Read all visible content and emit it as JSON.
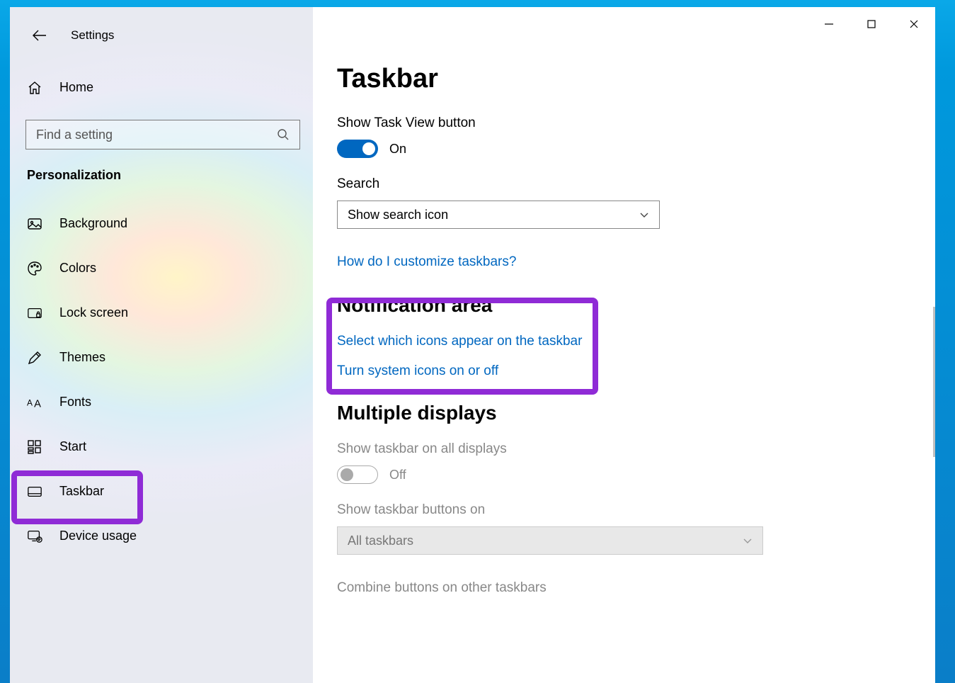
{
  "app_title": "Settings",
  "sidebar": {
    "home": "Home",
    "search_placeholder": "Find a setting",
    "category": "Personalization",
    "items": [
      {
        "label": "Background"
      },
      {
        "label": "Colors"
      },
      {
        "label": "Lock screen"
      },
      {
        "label": "Themes"
      },
      {
        "label": "Fonts"
      },
      {
        "label": "Start"
      },
      {
        "label": "Taskbar"
      },
      {
        "label": "Device usage"
      }
    ]
  },
  "main": {
    "title": "Taskbar",
    "taskview_label": "Show Task View button",
    "taskview_state": "On",
    "search_label": "Search",
    "search_dropdown": "Show search icon",
    "help_link": "How do I customize taskbars?",
    "notif_heading": "Notification area",
    "notif_link1": "Select which icons appear on the taskbar",
    "notif_link2": "Turn system icons on or off",
    "multi_heading": "Multiple displays",
    "multi_label": "Show taskbar on all displays",
    "multi_state": "Off",
    "buttons_label": "Show taskbar buttons on",
    "buttons_dropdown": "All taskbars",
    "combine_label": "Combine buttons on other taskbars"
  }
}
